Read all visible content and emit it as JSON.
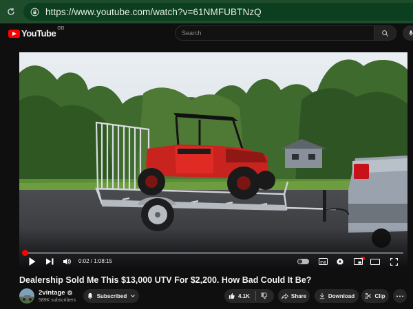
{
  "browser": {
    "url": "https://www.youtube.com/watch?v=61NMFUBTNzQ"
  },
  "masthead": {
    "logo_text": "YouTube",
    "region": "GB",
    "search_placeholder": "Search"
  },
  "player": {
    "current_time": "0:02",
    "duration": "1:08:15",
    "progress_fraction": 0.0005
  },
  "video": {
    "title": "Dealership Sold Me This $13,000 UTV For $2,200. How Bad Could It Be?"
  },
  "channel": {
    "name": "2vintage",
    "subscribers": "589K subscribers"
  },
  "actions": {
    "subscribed_label": "Subscribed",
    "like_count": "4.1K",
    "share_label": "Share",
    "download_label": "Download",
    "clip_label": "Clip"
  },
  "colors": {
    "accent": "#ff0000",
    "browser_bar": "#1f4d2c"
  },
  "icons": {
    "reload": "reload-icon",
    "lock": "lock-icon",
    "search": "search-icon",
    "mic": "mic-icon",
    "play": "play-icon",
    "next": "next-icon",
    "volume": "volume-icon",
    "subtitles": "subtitles-icon",
    "settings": "settings-icon",
    "miniplayer": "miniplayer-icon",
    "theater": "theater-icon",
    "fullscreen": "fullscreen-icon",
    "bell": "bell-icon",
    "like": "thumbs-up-icon",
    "dislike": "thumbs-down-icon",
    "share": "share-icon",
    "download": "download-icon",
    "clip": "scissors-icon",
    "more": "more-icon"
  }
}
